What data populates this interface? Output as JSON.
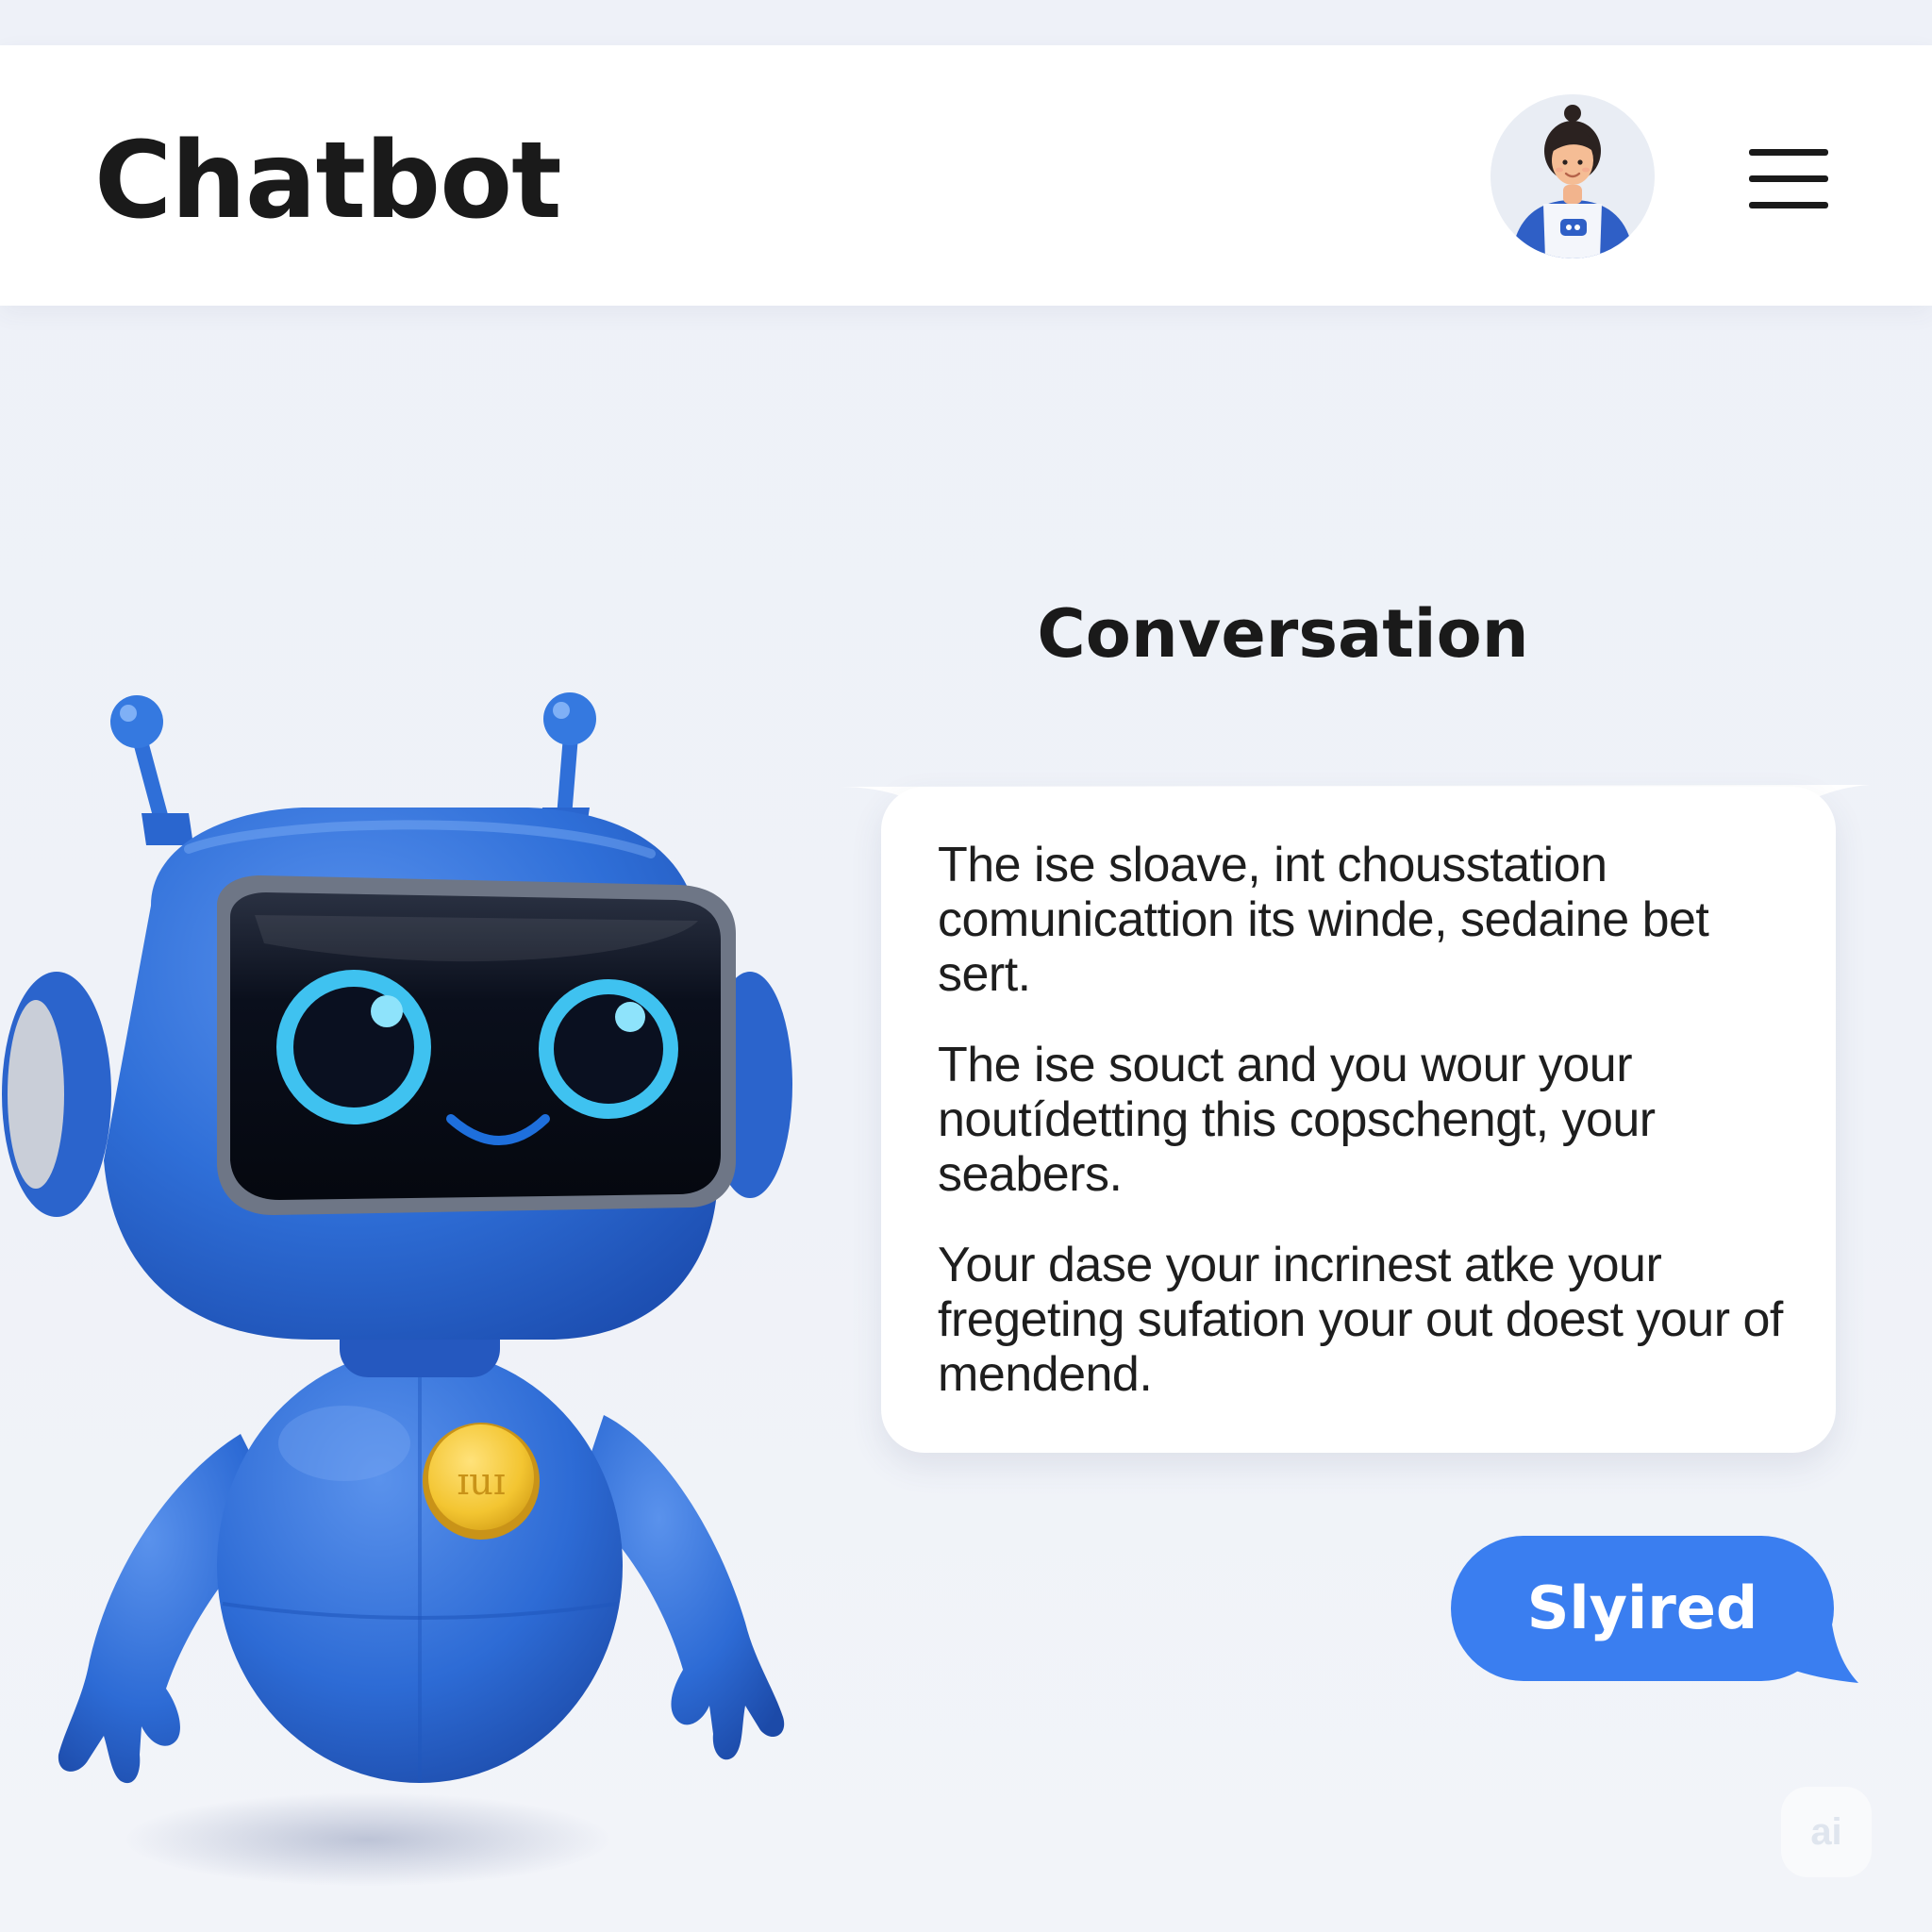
{
  "header": {
    "title": "Chatbot",
    "avatar_icon": "user-avatar-icon",
    "menu_icon": "hamburger-menu-icon"
  },
  "conversation": {
    "title": "Conversation",
    "bot_messages": [
      "The ise sloave, int chousstation comunicattion its winde, sedaine bet sert.",
      "The ise souct and  you wour your noutídetting this copschengt, your seabers.",
      "Your dase your incrinest atke your fregeting sufation your out doest your of mendend."
    ],
    "user_reply": "Slyired"
  },
  "mascot": {
    "badge_text": "ɪuɪ",
    "icon": "robot-mascot-icon"
  },
  "watermark": {
    "text": "ai"
  },
  "colors": {
    "background": "#eef1f7",
    "header_background": "#ffffff",
    "accent_blue": "#3a7ef0",
    "robot_blue": "#2f6fd8",
    "eye_cyan": "#5ad0f5",
    "badge_yellow": "#f3c531",
    "text_dark": "#1a1a1a"
  }
}
